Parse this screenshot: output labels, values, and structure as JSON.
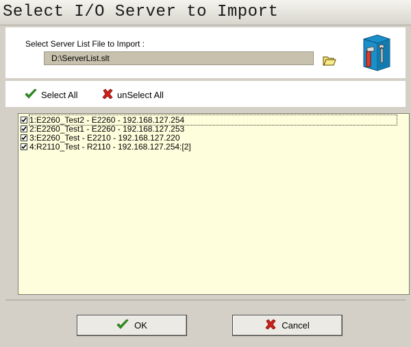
{
  "window": {
    "title": "Select I/O Server to Import"
  },
  "file": {
    "label": "Select Server List File to Import :",
    "value": "D:\\ServerList.slt"
  },
  "toolbar": {
    "select_all": "Select All",
    "unselect_all": "unSelect All"
  },
  "servers": [
    {
      "label": "1:E2260_Test2 - E2260 - 192.168.127.254",
      "checked": true
    },
    {
      "label": "2:E2260_Test1 - E2260 - 192.168.127.253",
      "checked": true
    },
    {
      "label": "3:E2260_Test - E2210 - 192.168.127.220",
      "checked": true
    },
    {
      "label": "4:R2110_Test - R2110 - 192.168.127.254:[2]",
      "checked": true
    }
  ],
  "buttons": {
    "ok": "OK",
    "cancel": "Cancel"
  },
  "icons": {
    "folder": "folder-open-icon",
    "tool": "toolbox-icon",
    "check": "green-check-icon",
    "cross": "red-x-icon"
  },
  "colors": {
    "check_green": "#2e9a1e",
    "cross_red": "#d0201a",
    "list_bg": "#fefedc",
    "input_bg": "#c7c1ad"
  }
}
